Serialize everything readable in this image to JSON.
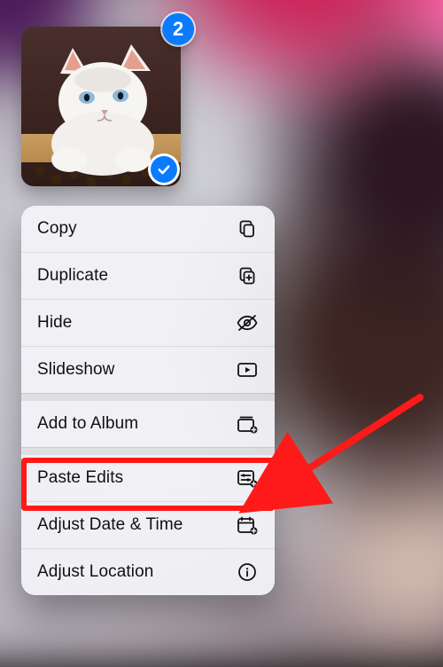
{
  "selection": {
    "count": 2,
    "checked": true
  },
  "menu": {
    "copy": {
      "label": "Copy"
    },
    "duplicate": {
      "label": "Duplicate"
    },
    "hide": {
      "label": "Hide"
    },
    "slideshow": {
      "label": "Slideshow"
    },
    "add_album": {
      "label": "Add to Album"
    },
    "paste_edits": {
      "label": "Paste Edits"
    },
    "adjust_dt": {
      "label": "Adjust Date & Time"
    },
    "adjust_loc": {
      "label": "Adjust Location"
    }
  },
  "annotation": {
    "highlight_target": "paste_edits",
    "arrow_color": "#ff1a1a"
  }
}
